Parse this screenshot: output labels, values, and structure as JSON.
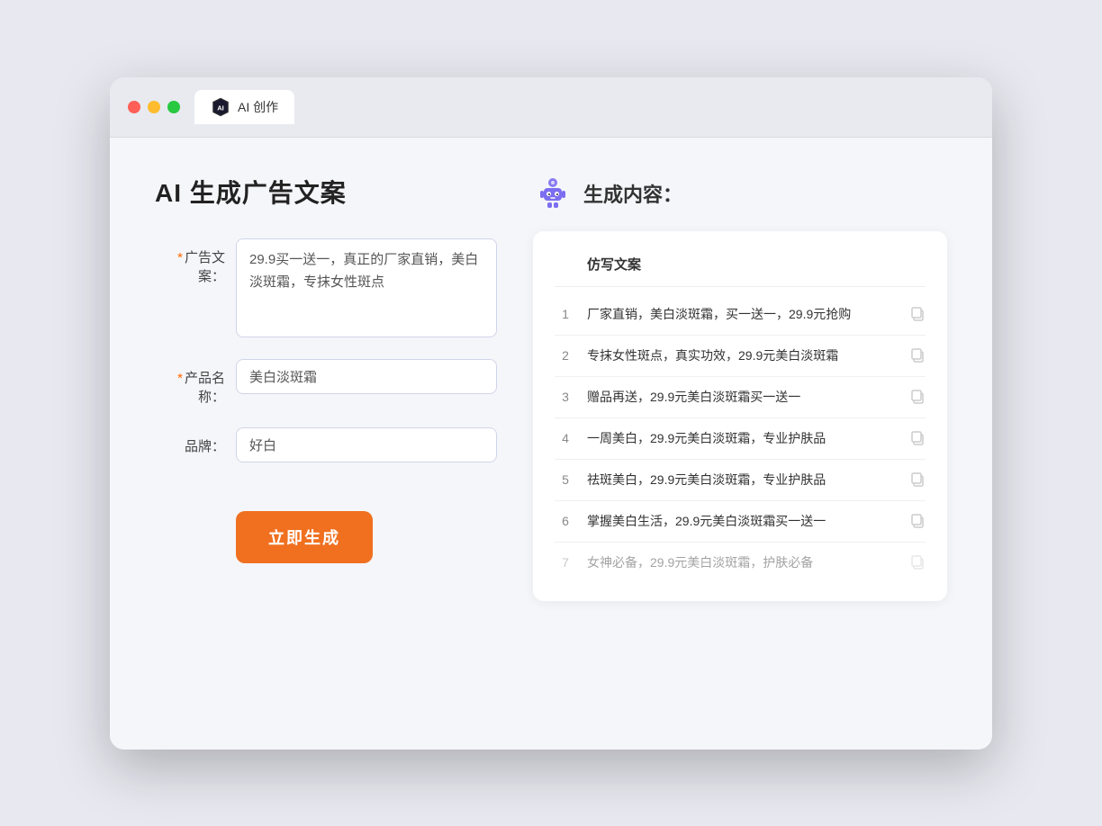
{
  "browser": {
    "tab_label": "AI 创作",
    "traffic": {
      "red": "red",
      "yellow": "yellow",
      "green": "green"
    }
  },
  "left_panel": {
    "title": "AI  生成广告文案",
    "form": {
      "ad_copy_label": "广告文案：",
      "ad_copy_placeholder": "29.9买一送一，真正的厂家直销，美白淡斑霜，专抹女性斑点",
      "product_name_label": "产品名称：",
      "product_name_value": "美白淡斑霜",
      "brand_label": "品牌：",
      "brand_value": "好白"
    },
    "generate_button": "立即生成",
    "required_label": "广告文案",
    "required_label2": "产品名称"
  },
  "right_panel": {
    "title": "生成内容：",
    "table_header": "仿写文案",
    "results": [
      {
        "num": "1",
        "text": "厂家直销，美白淡斑霜，买一送一，29.9元抢购"
      },
      {
        "num": "2",
        "text": "专抹女性斑点，真实功效，29.9元美白淡斑霜"
      },
      {
        "num": "3",
        "text": "赠品再送，29.9元美白淡斑霜买一送一"
      },
      {
        "num": "4",
        "text": "一周美白，29.9元美白淡斑霜，专业护肤品"
      },
      {
        "num": "5",
        "text": "祛斑美白，29.9元美白淡斑霜，专业护肤品"
      },
      {
        "num": "6",
        "text": "掌握美白生活，29.9元美白淡斑霜买一送一"
      },
      {
        "num": "7",
        "text": "女神必备，29.9元美白淡斑霜，护肤必备"
      }
    ]
  }
}
